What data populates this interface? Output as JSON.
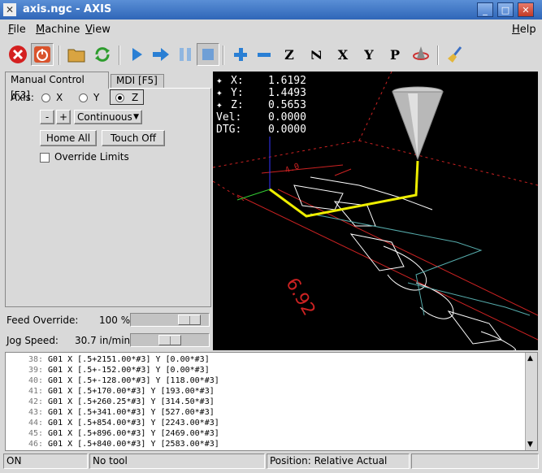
{
  "window": {
    "title": "axis.ngc - AXIS"
  },
  "menu": {
    "items": [
      {
        "label": "File",
        "underline": "F",
        "rest": "ile"
      },
      {
        "label": "Machine",
        "underline": "M",
        "rest": "achine"
      },
      {
        "label": "View",
        "underline": "V",
        "rest": "iew"
      },
      {
        "label": "Help",
        "underline": "H",
        "rest": "elp"
      }
    ]
  },
  "toolbar": {
    "axis_letters": [
      "Z",
      "Z",
      "X",
      "Y",
      "P"
    ]
  },
  "tabs": [
    "Manual Control [F3]",
    "MDI [F5]"
  ],
  "manual": {
    "axis_label": "Axis:",
    "axes": [
      "X",
      "Y",
      "Z"
    ],
    "selected_axis": "Z",
    "minus_label": "-",
    "plus_label": "+",
    "jog_mode": "Continuous",
    "home_all": "Home All",
    "touch_off": "Touch Off",
    "override_limits": "Override Limits"
  },
  "feed": {
    "label": "Feed Override:",
    "value": "100 %"
  },
  "jog": {
    "label": "Jog Speed:",
    "value": "30.7 in/min"
  },
  "dro": {
    "rows": [
      {
        "name": "X:",
        "value": "1.6192"
      },
      {
        "name": "Y:",
        "value": "1.4493"
      },
      {
        "name": "Z:",
        "value": "0.5653"
      },
      {
        "name": "Vel:",
        "value": "0.0000"
      },
      {
        "name": "DTG:",
        "value": "0.0000"
      }
    ],
    "dimension_label": "6.92"
  },
  "gcode": {
    "lines": [
      {
        "n": "38:",
        "t": "G01 X [.5+2151.00*#3] Y [0.00*#3]"
      },
      {
        "n": "39:",
        "t": "G01 X [.5+-152.00*#3] Y [0.00*#3]"
      },
      {
        "n": "40:",
        "t": "G01 X [.5+-128.00*#3] Y [118.00*#3]"
      },
      {
        "n": "41:",
        "t": "G01 X [.5+170.00*#3] Y [193.00*#3]"
      },
      {
        "n": "42:",
        "t": "G01 X [.5+260.25*#3] Y [314.50*#3]"
      },
      {
        "n": "43:",
        "t": "G01 X [.5+341.00*#3] Y [527.00*#3]"
      },
      {
        "n": "44:",
        "t": "G01 X [.5+854.00*#3] Y [2243.00*#3]"
      },
      {
        "n": "45:",
        "t": "G01 X [.5+896.00*#3] Y [2469.00*#3]"
      },
      {
        "n": "46:",
        "t": "G01 X [.5+840.00*#3] Y [2583.00*#3]"
      }
    ]
  },
  "status": {
    "machine": "ON",
    "tool": "No tool",
    "position": "Position: Relative Actual"
  }
}
